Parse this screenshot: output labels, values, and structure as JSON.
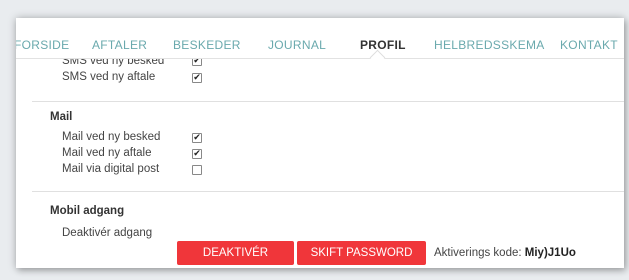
{
  "nav": {
    "tabs": [
      {
        "label": "FORSIDE",
        "active": false
      },
      {
        "label": "AFTALER",
        "active": false
      },
      {
        "label": "BESKEDER",
        "active": false
      },
      {
        "label": "JOURNAL",
        "active": false
      },
      {
        "label": "PROFIL",
        "active": true
      },
      {
        "label": "HELBREDSSKEMA",
        "active": false
      },
      {
        "label": "KONTAKT",
        "active": false
      }
    ]
  },
  "sms": {
    "items": [
      {
        "label": "SMS ved ny besked",
        "checked": true
      },
      {
        "label": "SMS ved ny aftale",
        "checked": true
      }
    ]
  },
  "mail": {
    "title": "Mail",
    "items": [
      {
        "label": "Mail ved ny besked",
        "checked": true
      },
      {
        "label": "Mail ved ny aftale",
        "checked": true
      },
      {
        "label": "Mail via digital post",
        "checked": false
      }
    ]
  },
  "mobile": {
    "title": "Mobil adgang",
    "deactivate_label": "Deaktivér adgang",
    "deactivate_button": "DEAKTIVÉR",
    "change_password_button": "SKIFT PASSWORD",
    "activation_code_label": "Aktiverings kode:",
    "activation_code_value": "Miy)J1Uo"
  },
  "colors": {
    "accent_tab": "#6aa9ad",
    "button_red": "#f0363a"
  }
}
